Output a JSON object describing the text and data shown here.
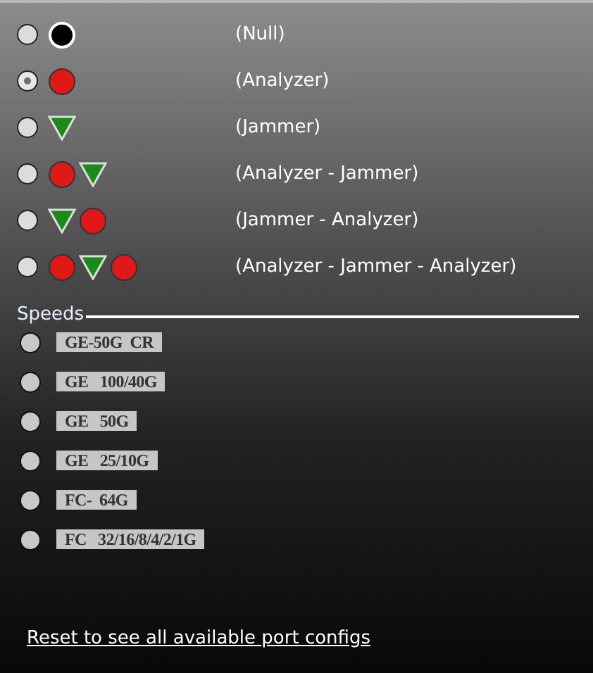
{
  "modes": [
    {
      "selected": false,
      "icons": [
        {
          "kind": "null"
        }
      ],
      "label": "(Null)"
    },
    {
      "selected": true,
      "icons": [
        {
          "kind": "analyzer"
        }
      ],
      "label": "(Analyzer)"
    },
    {
      "selected": false,
      "icons": [
        {
          "kind": "jammer"
        }
      ],
      "label": "(Jammer)"
    },
    {
      "selected": false,
      "icons": [
        {
          "kind": "analyzer"
        },
        {
          "kind": "jammer"
        }
      ],
      "label": "(Analyzer - Jammer)"
    },
    {
      "selected": false,
      "icons": [
        {
          "kind": "jammer"
        },
        {
          "kind": "analyzer"
        }
      ],
      "label": "(Jammer - Analyzer)"
    },
    {
      "selected": false,
      "icons": [
        {
          "kind": "analyzer"
        },
        {
          "kind": "jammer"
        },
        {
          "kind": "analyzer"
        }
      ],
      "label": "(Analyzer - Jammer - Analyzer)"
    }
  ],
  "speeds": {
    "title": "Speeds",
    "items": [
      {
        "selected": false,
        "label": "GE-50G  CR"
      },
      {
        "selected": false,
        "label": "GE   100/40G"
      },
      {
        "selected": false,
        "label": "GE   50G"
      },
      {
        "selected": false,
        "label": "GE   25/10G"
      },
      {
        "selected": false,
        "label": "FC-  64G"
      },
      {
        "selected": false,
        "label": "FC   32/16/8/4/2/1G"
      }
    ]
  },
  "reset_link": "Reset to see all available port configs"
}
